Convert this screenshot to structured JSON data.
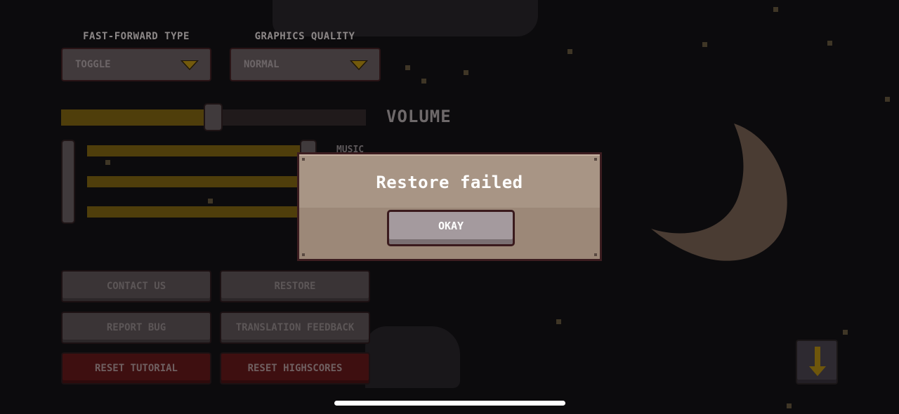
{
  "settings": {
    "fast_forward": {
      "label": "FAST-FORWARD TYPE",
      "value": "TOGGLE",
      "icon": "dropdown-triangle-icon"
    },
    "graphics": {
      "label": "GRAPHICS QUALITY",
      "value": "NORMAL",
      "icon": "dropdown-triangle-icon"
    },
    "volume": {
      "label": "VOLUME",
      "master_level": 0.5,
      "channels": [
        {
          "label": "MUSIC",
          "level": 1.0
        },
        {
          "label": "",
          "level": 1.0
        },
        {
          "label": "",
          "level": 1.0
        }
      ]
    },
    "buttons": {
      "contact_us": "CONTACT US",
      "restore": "RESTORE",
      "report_bug": "REPORT BUG",
      "translation_feedback": "TRANSLATION FEEDBACK",
      "reset_tutorial": "RESET TUTORIAL",
      "reset_highscores": "RESET HIGHSCORES"
    },
    "scroll_down_icon": "arrow-down-icon"
  },
  "dialog": {
    "title": "Restore failed",
    "okay_label": "OKAY"
  },
  "colors": {
    "background": "#0c0b0d",
    "accent_gold": "#735a0c",
    "danger_red": "#3e0f10",
    "dialog_bg": "#a89585"
  }
}
